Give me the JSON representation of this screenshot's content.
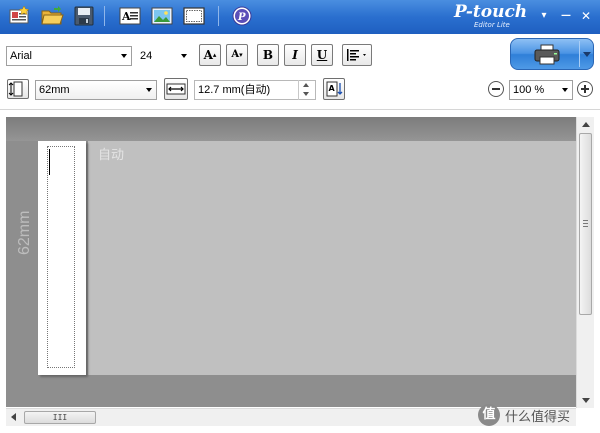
{
  "app": {
    "brand": "P-touch",
    "subbrand": "Editor Lite"
  },
  "window_controls": {
    "menu": "▾",
    "minimize": "—",
    "close": "✕"
  },
  "font_bar": {
    "font_name": "Arial",
    "font_size": "24",
    "bold_label": "B",
    "italic_label": "I",
    "underline_label": "U",
    "grow_label": "A",
    "shrink_label": "A"
  },
  "layout_bar": {
    "tape_width": "62mm",
    "label_length": "12.7 mm(自动)",
    "zoom": "100 %",
    "align_label": "A"
  },
  "canvas": {
    "auto_label": "自动",
    "width_label": "62mm"
  },
  "hscroll": {
    "grip": "III"
  },
  "watermark": {
    "logo_char": "值",
    "text": "什么值得买"
  },
  "colors": {
    "titlebar": "#2a6fcf",
    "print_button": "#4a93e4",
    "canvas": "#8e8e8e",
    "tape": "#c0c0c0"
  }
}
